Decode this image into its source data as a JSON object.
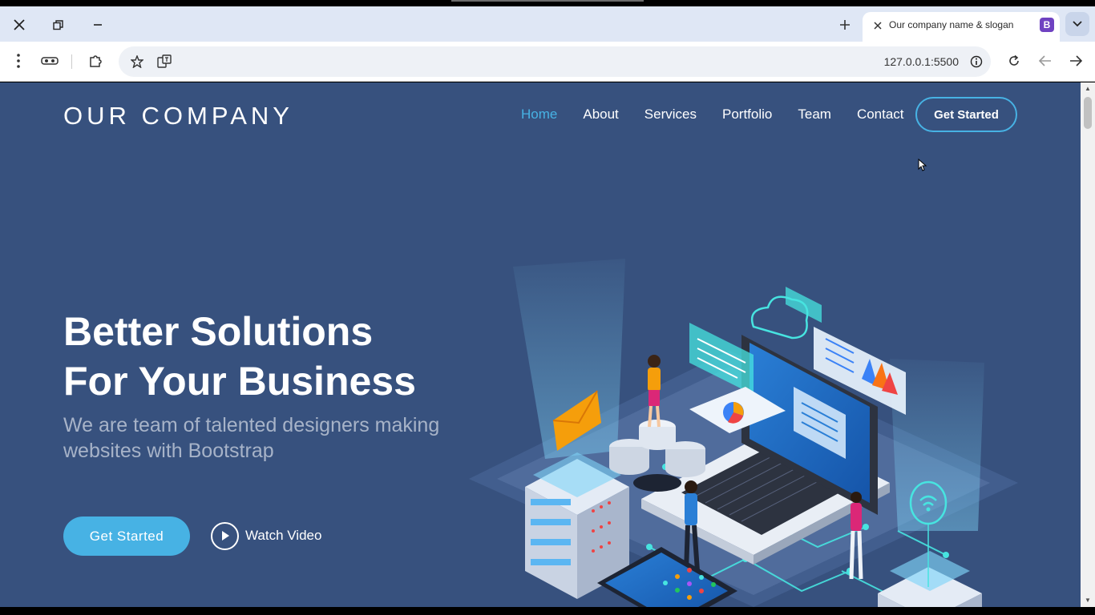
{
  "browser": {
    "tab_title": "Our company name & slogan",
    "favicon_letter": "B",
    "url": "127.0.0.1:5500"
  },
  "site": {
    "logo": "OUR COMPANY",
    "nav": [
      {
        "label": "Home",
        "active": true
      },
      {
        "label": "About"
      },
      {
        "label": "Services"
      },
      {
        "label": "Portfolio"
      },
      {
        "label": "Team"
      },
      {
        "label": "Contact"
      }
    ],
    "nav_cta": "Get Started",
    "hero": {
      "title_line1": "Better Solutions",
      "title_line2": "For Your Business",
      "subtitle": "We are team of talented designers making websites with Bootstrap",
      "primary_button": "Get Started",
      "video_link": "Watch Video"
    }
  },
  "colors": {
    "background": "#37517e",
    "accent": "#47b2e4",
    "favicon": "#6f42c1"
  }
}
